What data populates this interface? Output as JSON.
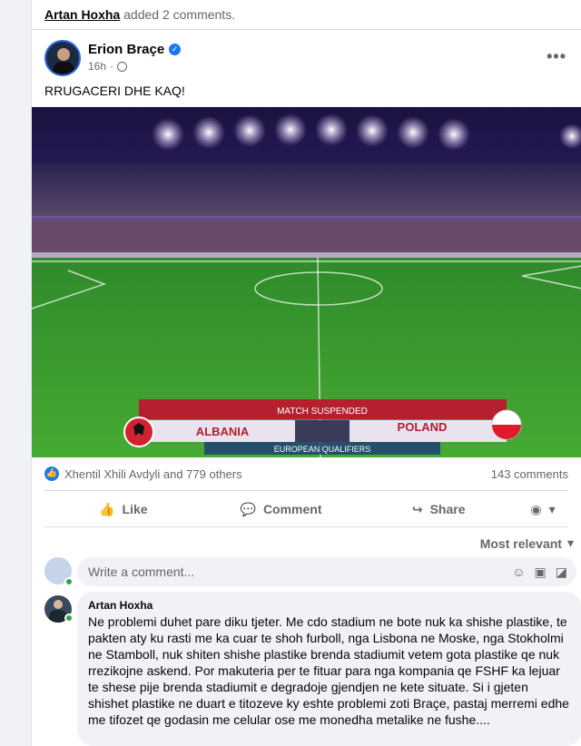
{
  "activity": {
    "actor": "Artan Hoxha",
    "action": "added 2 comments."
  },
  "post": {
    "author": "Erion Braçe",
    "time": "16h",
    "text": "RRUGACERI DHE KAQ!",
    "more_label": "•••"
  },
  "media": {
    "banner_top": "MATCH SUSPENDED",
    "team_home": "ALBANIA",
    "team_away": "POLAND",
    "banner_bottom": "EUROPEAN QUALIFIERS"
  },
  "reactions": {
    "summary": "Xhentil Xhili Avdyli and 779 others",
    "comments_count": "143 comments"
  },
  "actions": {
    "like": "Like",
    "comment": "Comment",
    "share": "Share"
  },
  "sort": {
    "label": "Most relevant"
  },
  "composer": {
    "placeholder": "Write a comment..."
  },
  "comment": {
    "author": "Artan Hoxha",
    "text": "Ne problemi duhet pare diku tjeter. Me cdo stadium ne bote nuk ka shishe plastike, te pakten aty ku rasti me ka cuar te shoh furboll, nga Lisbona ne Moske, nga Stokholmi ne Stamboll, nuk shiten shishe plastike brenda stadiumit vetem gota plastike qe nuk rrezikojne askend. Por makuteria per te fituar para nga kompania qe FSHF ka lejuar te shese pije brenda stadiumit e degradoje gjendjen ne kete situate. Si i gjeten shishet plastike ne duart e titozeve ky eshte problemi zoti Braçe, pastaj merremi edhe me tifozet qe godasin me celular ose me monedha metalike ne fushe...."
  },
  "colors": {
    "brand": "#1877f2",
    "online": "#31a24c",
    "pitch": "#3c9a2e",
    "banner_red": "#b51f2e"
  }
}
